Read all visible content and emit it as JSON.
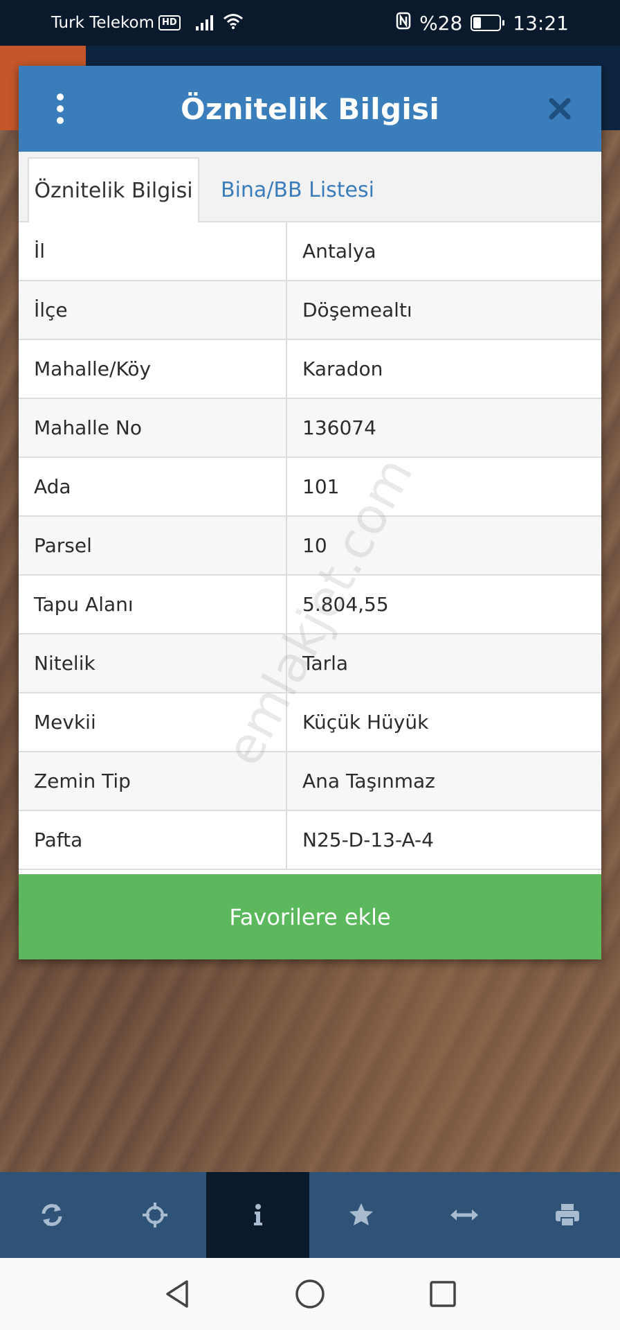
{
  "status_bar": {
    "carrier": "Turk Telekom",
    "hd_badge": "HD",
    "battery_percent": "%28",
    "time": "13:21",
    "icons": [
      "signal-icon",
      "wifi-icon",
      "nfc-icon",
      "battery-icon"
    ]
  },
  "modal": {
    "title": "Öznitelik Bilgisi",
    "tabs": [
      {
        "label": "Öznitelik Bilgisi",
        "active": true
      },
      {
        "label": "Bina/BB Listesi",
        "active": false
      }
    ],
    "rows": [
      {
        "label": "İl",
        "value": "Antalya"
      },
      {
        "label": "İlçe",
        "value": "Döşemealtı"
      },
      {
        "label": "Mahalle/Köy",
        "value": "Karadon"
      },
      {
        "label": "Mahalle No",
        "value": "136074"
      },
      {
        "label": "Ada",
        "value": "101"
      },
      {
        "label": "Parsel",
        "value": "10"
      },
      {
        "label": "Tapu Alanı",
        "value": "5.804,55"
      },
      {
        "label": "Nitelik",
        "value": "Tarla"
      },
      {
        "label": "Mevkii",
        "value": "Küçük Hüyük"
      },
      {
        "label": "Zemin Tip",
        "value": "Ana Taşınmaz"
      },
      {
        "label": "Pafta",
        "value": "N25-D-13-A-4"
      }
    ],
    "favorite_button": "Favorilere ekle",
    "watermark": "emlakjet.com"
  },
  "colors": {
    "header_blue": "#3a7dbb",
    "button_green": "#5cb85c",
    "toolbar": "#2f5277",
    "toolbar_active": "#0b1a2b"
  },
  "toolbar": {
    "buttons": [
      "refresh-icon",
      "locate-icon",
      "info-icon",
      "star-icon",
      "measure-icon",
      "print-icon"
    ],
    "active": "info-icon"
  },
  "nav_bar": {
    "buttons": [
      "back-icon",
      "home-icon",
      "recents-icon"
    ]
  }
}
